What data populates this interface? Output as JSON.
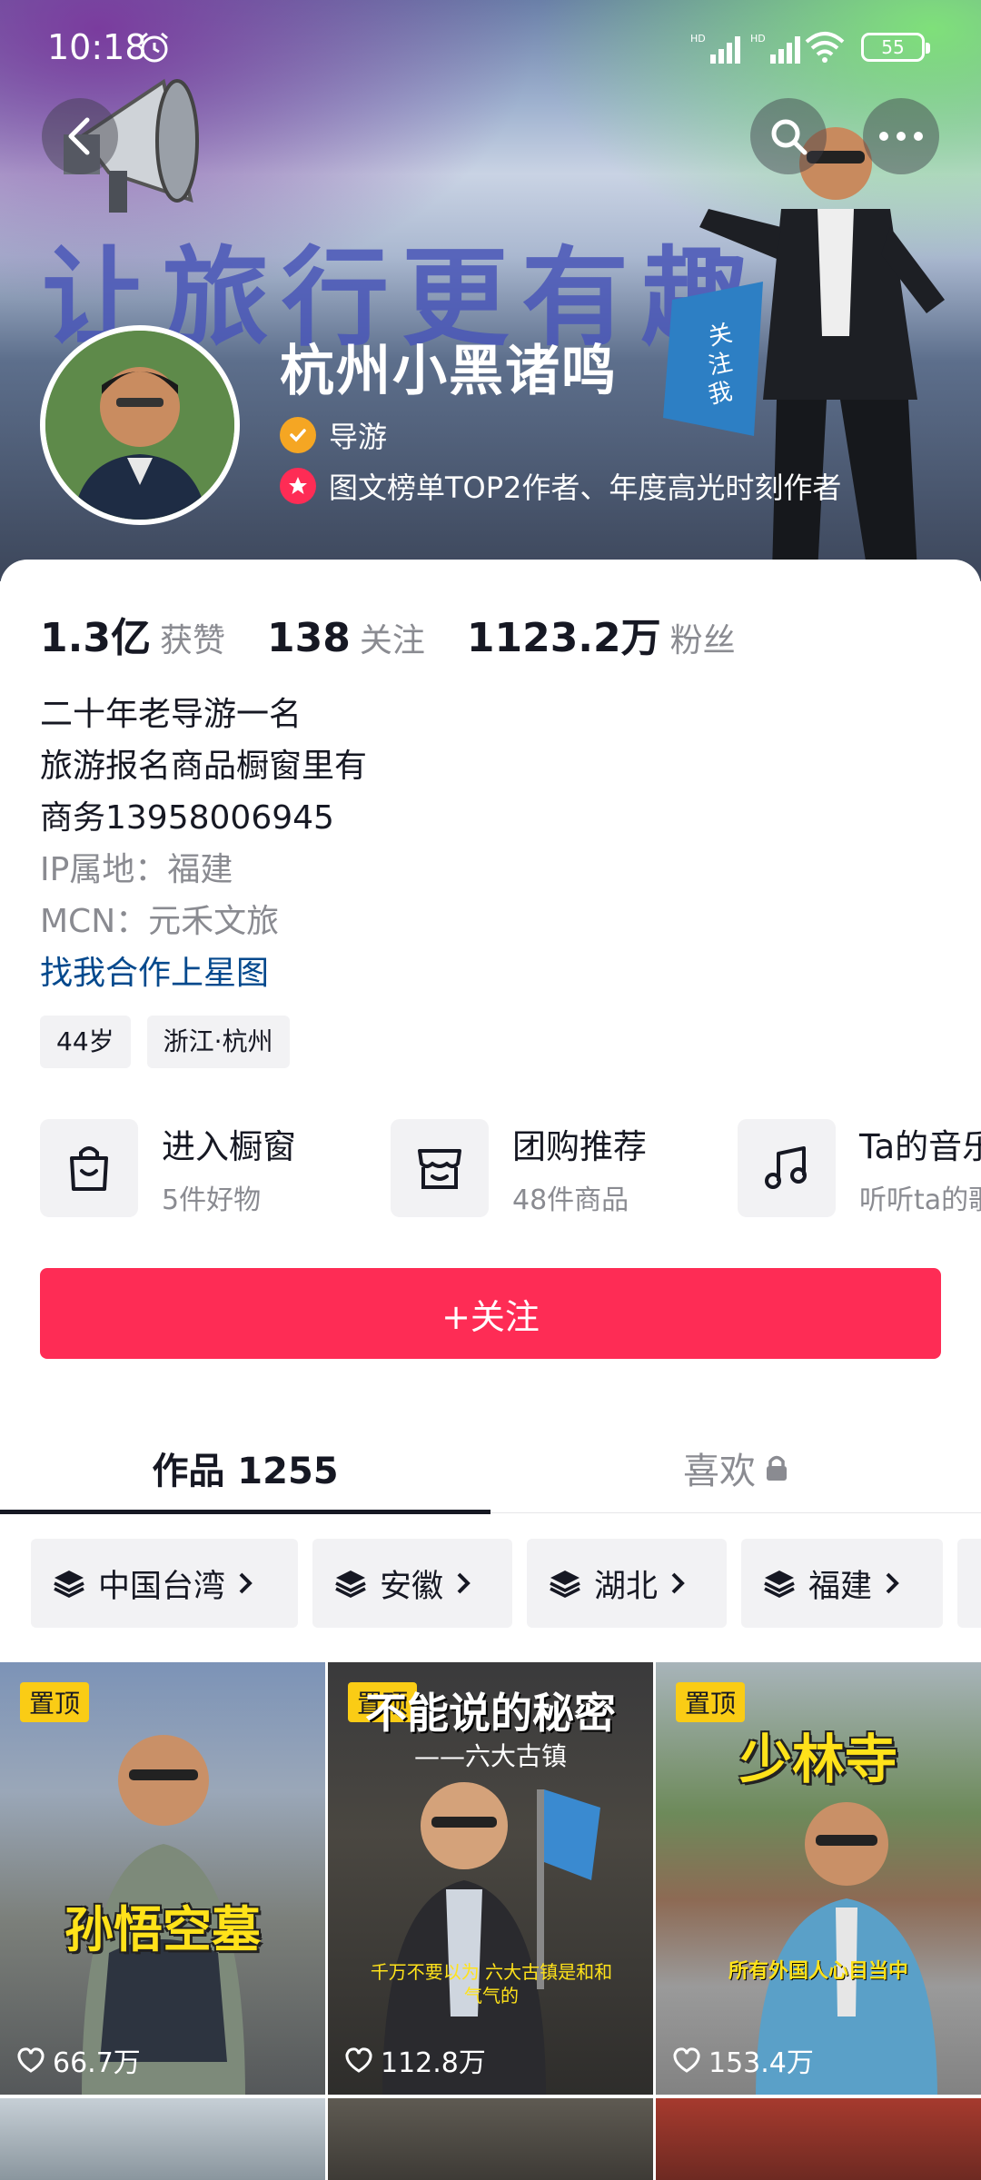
{
  "status_bar": {
    "time": "10:18",
    "battery": "55",
    "signal1": "HD",
    "signal2": "HD"
  },
  "banner": {
    "slogan": "让旅行更有趣",
    "flag_text": "关注我"
  },
  "profile": {
    "name": "杭州小黑诸鸣",
    "badge_role": "导游",
    "badge_honor": "图文榜单TOP2作者、年度高光时刻作者"
  },
  "stats": [
    {
      "value": "1.3亿",
      "label": "获赞"
    },
    {
      "value": "138",
      "label": "关注"
    },
    {
      "value": "1123.2万",
      "label": "粉丝"
    }
  ],
  "bio": {
    "line1": "二十年老导游一名",
    "line2": "旅游报名商品橱窗里有",
    "line3": "商务13958006945",
    "ip": "IP属地：福建",
    "mcn": "MCN：元禾文旅",
    "link": "找我合作上星图"
  },
  "tags": [
    "44岁",
    "浙江·杭州"
  ],
  "shortcuts": [
    {
      "title": "进入橱窗",
      "sub": "5件好物",
      "icon": "shopping-bag-icon"
    },
    {
      "title": "团购推荐",
      "sub": "48件商品",
      "icon": "store-icon"
    },
    {
      "title": "Ta的音乐",
      "sub": "听听ta的歌",
      "icon": "music-note-icon"
    }
  ],
  "follow_button": "+关注",
  "tabs": {
    "works": "作品 1255",
    "likes": "喜欢"
  },
  "collections": [
    "中国台湾",
    "安徽",
    "湖北",
    "福建"
  ],
  "videos": [
    {
      "pin": "置顶",
      "title": "孙悟空墓",
      "likes": "66.7万"
    },
    {
      "pin": "置顶",
      "title": "不能说的秘密",
      "subtitle": "——六大古镇",
      "caption": "千万不要以为 六大古镇是和和气气的",
      "likes": "112.8万"
    },
    {
      "pin": "置顶",
      "title": "少林寺",
      "caption": "所有外国人心目当中",
      "likes": "153.4万"
    }
  ],
  "colors": {
    "accent": "#fe2c55",
    "pin": "#facc15",
    "link": "#04498d"
  }
}
